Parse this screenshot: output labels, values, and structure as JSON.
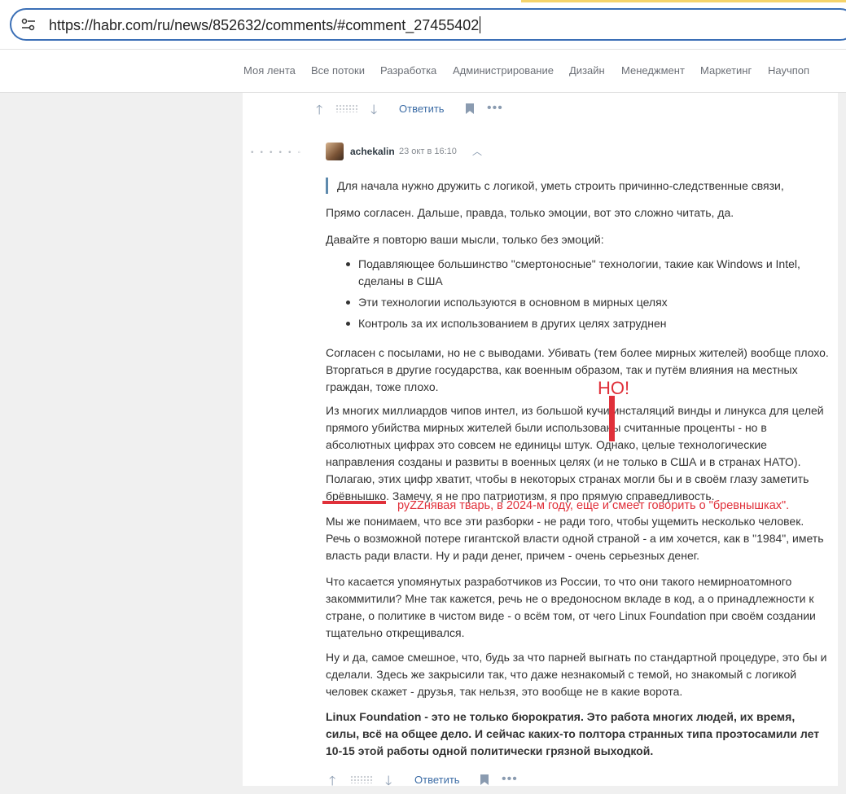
{
  "browser": {
    "url": "https://habr.com/ru/news/852632/comments/#comment_27455402"
  },
  "nav": {
    "items": [
      "Моя лента",
      "Все потоки",
      "Разработка",
      "Администрирование",
      "Дизайн",
      "Менеджмент",
      "Маркетинг",
      "Научпоп"
    ]
  },
  "top_actions": {
    "reply_label": "Ответить"
  },
  "comment": {
    "author": "achekalin",
    "time": "23 окт в 16:10",
    "quote": "Для начала нужно дружить с логикой, уметь строить причинно-следственные связи,",
    "p1": "Прямо согласен. Дальше, правда, только эмоции, вот это сложно читать, да.",
    "p2": "Давайте я повторю ваши мысли, только без эмоций:",
    "list": [
      "Подавляющее большинство \"смертоносные\" технологии, такие как Windows и Intel, сделаны в США",
      "Эти технологии используются в основном в мирных целях",
      "Контроль за их использованием в других целях затруднен"
    ],
    "p3": "Согласен с посылами, но не с выводами. Убивать (тем более мирных жителей) вообще плохо. Вторгаться в другие государства, как военным образом, так и путём влияния на местных граждан, тоже плохо.",
    "p4": "Из многих миллиардов чипов интел, из большой кучи инсталяций винды и линукса для целей прямого убийства мирных жителей были использованы считанные проценты - но в абсолютных цифрах это совсем не единицы штук. Однако, целые технологические направления созданы и развиты в военных целях (и не только в США и в странах НАТО). Полагаю, этих цифр хватит, чтобы в некоторых странах могли бы и в своём глазу заметить брёвнышко. Замечу, я не про патриотизм, я про прямую справедливость.",
    "p5": "Мы же понимаем, что все эти разборки - не ради того, чтобы ущемить несколько человек. Речь о возможной потере гигантской власти одной страной - а им хочется, как в \"1984\", иметь власть ради власти. Ну и ради денег, причем - очень серьезных денег.",
    "p6": "Что касается упомянутых разработчиков из России, то что они такого немирноатомного закоммитили? Мне так кажется, речь не о вредоносном вкладе в код, а о принадлежности к стране, о политике в чистом виде - о всём том, от чего Linux Foundation при своём создании тщательно открещивался.",
    "p7": "Ну и да, самое смешное, что, будь за что парней выгнать по стандартной процедуре, это бы и сделали. Здесь же закрысили так, что даже незнакомый с темой, но знакомый с логикой человек скажет - друзья, так нельзя, это вообще не в какие ворота.",
    "p8": "Linux Foundation - это не только бюрократия. Это работа многих людей, их время, силы, всё на общее дело. И сейчас каких-то полтора странных типа проэтосамили лет 10-15 этой работы одной политически грязной выходкой."
  },
  "bottom_actions": {
    "reply_label": "Ответить"
  },
  "annotations": {
    "no": "НО!",
    "comment": "руZZнявая тварь, в 2024-м году, еще и смеет говорить о \"бревнышках\".",
    "color": "#e0303a"
  }
}
